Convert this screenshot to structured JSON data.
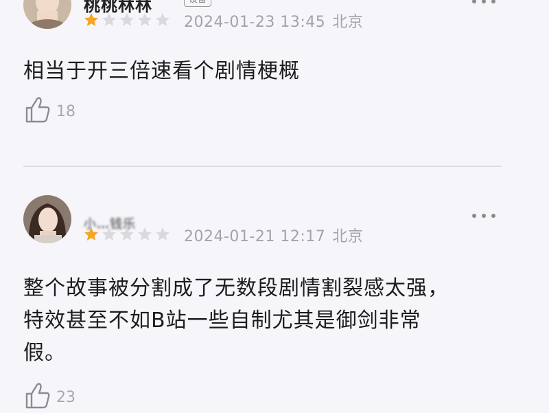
{
  "comments": [
    {
      "username": "桃桃林林",
      "badge": "设备",
      "rating": 1,
      "max_rating": 5,
      "date": "2024-01-23 13:45",
      "location": "北京",
      "text": "相当于开三倍速看个剧情梗概",
      "likes": "18"
    },
    {
      "username": "小…钱乐",
      "rating": 1,
      "max_rating": 5,
      "date": "2024-01-21 12:17",
      "location": "北京",
      "text_lines": [
        "整个故事被分割成了无数段剧情割裂感太强，",
        "特效甚至不如B站一些自制尤其是御剑非常",
        "假。"
      ],
      "likes": "23"
    }
  ],
  "colors": {
    "star_active": "#f5a623",
    "star_inactive": "#d9d9de",
    "meta_text": "#a3a3a7",
    "background": "#f6f5fa"
  },
  "icons": {
    "more": "more-horizontal-icon",
    "like": "thumbs-up-icon",
    "star": "star-icon"
  }
}
